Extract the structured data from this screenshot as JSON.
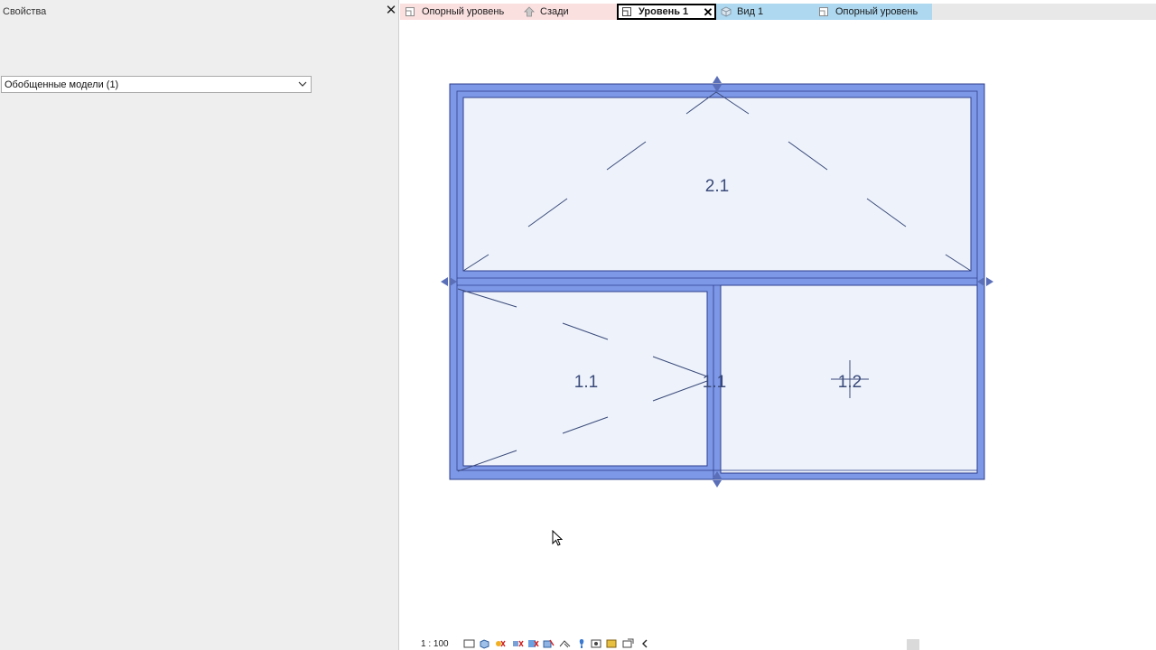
{
  "properties": {
    "title": "Свойства",
    "close_glyph": "✕",
    "type_selector": {
      "value": "Обобщенные модели (1)",
      "icon": "chevron-down-icon"
    }
  },
  "tabs": [
    {
      "label": "Опорный уровень",
      "icon": "floor-plan-icon",
      "bg": "#fbe0e0",
      "active": false
    },
    {
      "label": "Сзади",
      "icon": "elevation-icon",
      "bg": "#fbe0e0",
      "active": false
    },
    {
      "label": "Уровень 1",
      "icon": "floor-plan-icon",
      "bg": "#ffffff",
      "active": true,
      "close_glyph": "✕"
    },
    {
      "label": "Вид 1",
      "icon": "3d-view-icon",
      "bg": "#add8f0",
      "active": false
    },
    {
      "label": "Опорный уровень",
      "icon": "floor-plan-icon",
      "bg": "#add8f0",
      "active": false
    }
  ],
  "drawing": {
    "room_tags": [
      "2.1",
      "1.1",
      "1.1",
      "1.2"
    ],
    "colors": {
      "wall_fill": "#7d98e6",
      "wall_stroke": "#2f3f8f",
      "room_fill": "#eef3fb",
      "line": "#3a4a7a",
      "arrow": "#5a6fb8"
    }
  },
  "viewbar": {
    "scale": "1 : 100",
    "icons": [
      "detail-level-icon",
      "visual-style-icon",
      "sun-path-icon",
      "shadows-icon",
      "render-icon",
      "crop-view-icon",
      "crop-region-icon",
      "lock-3d-icon",
      "temporary-hide-icon",
      "reveal-hidden-icon",
      "temporary-view-properties-icon",
      "analytical-model-icon",
      "collapse-icon"
    ]
  }
}
